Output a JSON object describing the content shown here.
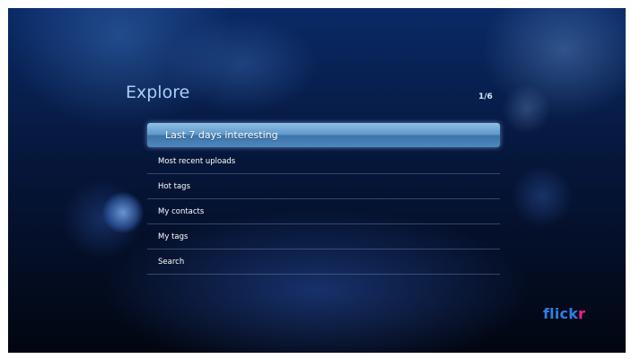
{
  "header": {
    "title": "Explore",
    "page_indicator": "1/6"
  },
  "menu": {
    "items": [
      {
        "label": "Last 7 days interesting",
        "selected": true
      },
      {
        "label": "Most recent uploads",
        "selected": false
      },
      {
        "label": "Hot tags",
        "selected": false
      },
      {
        "label": "My contacts",
        "selected": false
      },
      {
        "label": "My tags",
        "selected": false
      },
      {
        "label": "Search",
        "selected": false
      }
    ]
  },
  "brand": {
    "part1": "flick",
    "part2": "r",
    "color1": "#2f7fe0",
    "color2": "#ff1f8a"
  },
  "colors": {
    "selection_highlight": "#5e97c9",
    "title_text": "#a9cdf6",
    "background": "#06163a"
  }
}
